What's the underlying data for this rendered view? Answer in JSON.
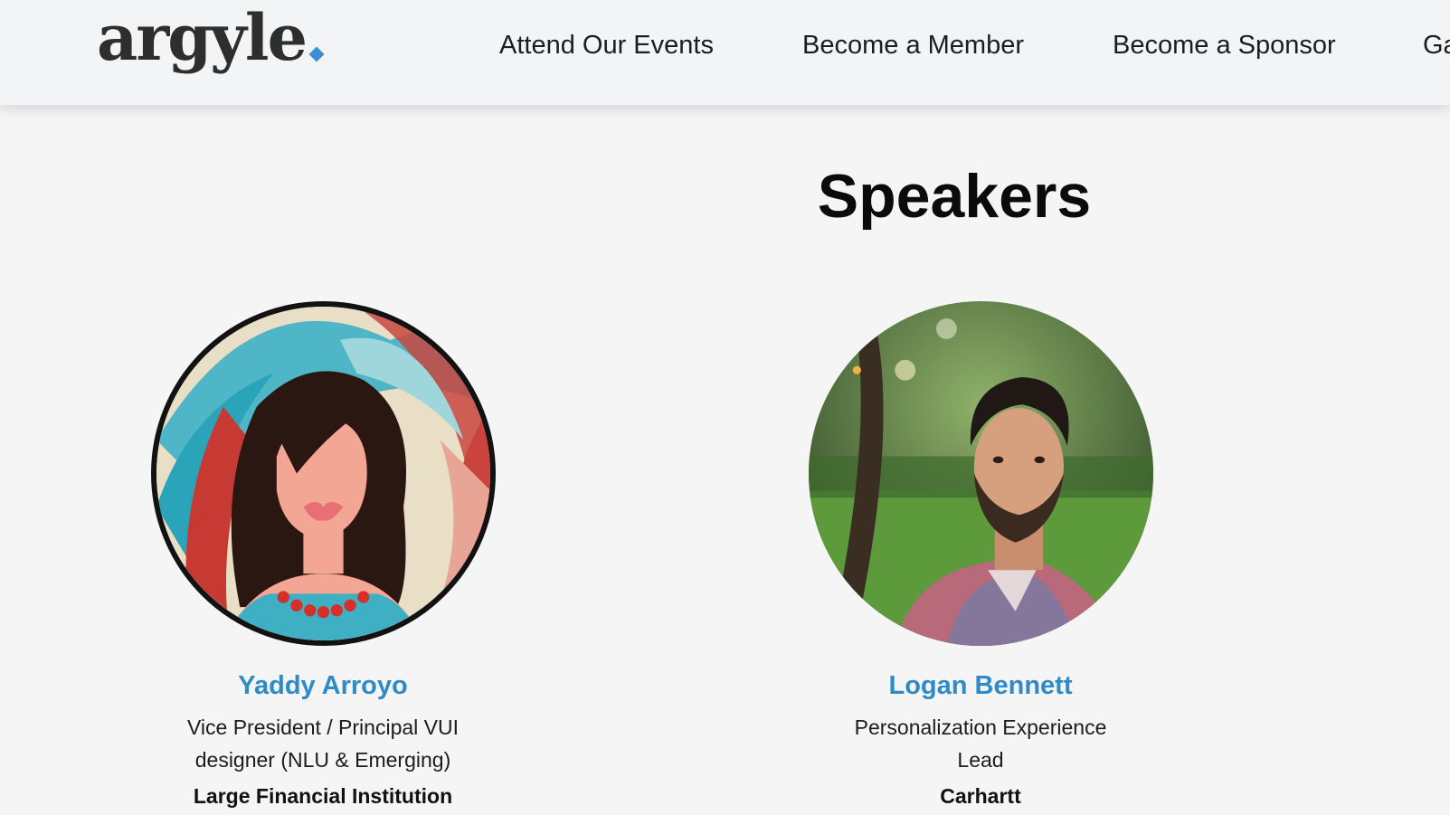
{
  "header": {
    "logo_text": "argyle",
    "nav": [
      {
        "label": "Attend Our Events"
      },
      {
        "label": "Become a Member"
      },
      {
        "label": "Become a Sponsor"
      },
      {
        "label": "Ga"
      }
    ]
  },
  "main": {
    "title": "Speakers",
    "speakers": [
      {
        "name": "Yaddy Arroyo",
        "role_line1": "Vice President / Principal VUI",
        "role_line2": "designer (NLU & Emerging)",
        "company": "Large Financial Institution",
        "avatar": "illustrated-woman-avatar"
      },
      {
        "name": "Logan Bennett",
        "role_line1": "Personalization Experience",
        "role_line2": "Lead",
        "company": "Carhartt",
        "avatar": "man-photo-avatar"
      }
    ]
  },
  "colors": {
    "background": "#f5f5f6",
    "header": "#f3f4f6",
    "accent_blue": "#2f8ac9",
    "logo_dot": "#3d8dd1"
  }
}
